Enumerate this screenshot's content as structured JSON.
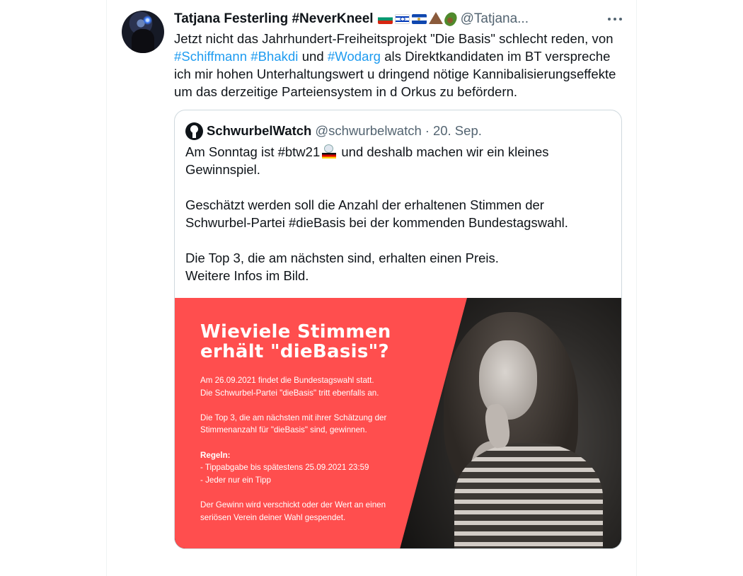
{
  "tweet": {
    "display_name": "Tatjana Festerling #NeverKneel",
    "flags_icons": [
      "bulgaria-flag-icon",
      "israel-flag-icon",
      "el-salvador-flag-icon",
      "volcano-icon",
      "avocado-icon"
    ],
    "handle": "@Tatjana...",
    "text_parts": {
      "p1": "Jetzt nicht das Jahrhundert-Freiheitsprojekt \"Die Basis\" schlecht reden, von ",
      "tag1": "#Schiffmann",
      "tag2": "#Bhakdi",
      "p2": "und",
      "tag3": "#Wodarg",
      "p3": "als Direktkandidaten im BT verspreche ich mir hohen Unterhaltungswert u dringend nötige Kannibalisierungseffekte um das derzeitige Parteiensystem in d Orkus zu befördern."
    }
  },
  "quote": {
    "name": "SchwurbelWatch",
    "handle": "@schwurbelwatch",
    "separator": "·",
    "date": "20. Sep.",
    "text_before_emoji": "Am Sonntag ist #btw21",
    "text_after_emoji": "und deshalb machen wir ein kleines Gewinnspiel.",
    "text_rest": "Geschätzt werden soll die Anzahl der erhaltenen Stimmen der Schwurbel-Partei #dieBasis bei der kommenden Bundestagswahl.\n\nDie Top 3, die am nächsten sind, erhalten einen Preis.\nWeitere Infos im Bild."
  },
  "image": {
    "title_line1": "Wieviele Stimmen",
    "title_line2": "erhält \"dieBasis\"?",
    "para1": "Am 26.09.2021 findet die Bundestagswahl statt.\nDie Schwurbel-Partei \"dieBasis\" tritt ebenfalls an.",
    "para2": "Die Top 3, die am nächsten mit ihrer Schätzung der\nStimmenanzahl für \"dieBasis\" sind, gewinnen.",
    "rules_heading": "Regeln:",
    "rules": "- Tippabgabe bis spätestens 25.09.2021 23:59\n- Jeder nur ein Tipp",
    "para3": "Der Gewinn wird verschickt oder der Wert an einen\nseriösen Verein deiner Wahl gespendet.",
    "colors": {
      "panel": "#ff4e4e",
      "text": "#ffffff"
    }
  },
  "colors": {
    "link": "#1d9bf0",
    "secondary_text": "#536471",
    "border": "#cfd9de"
  }
}
